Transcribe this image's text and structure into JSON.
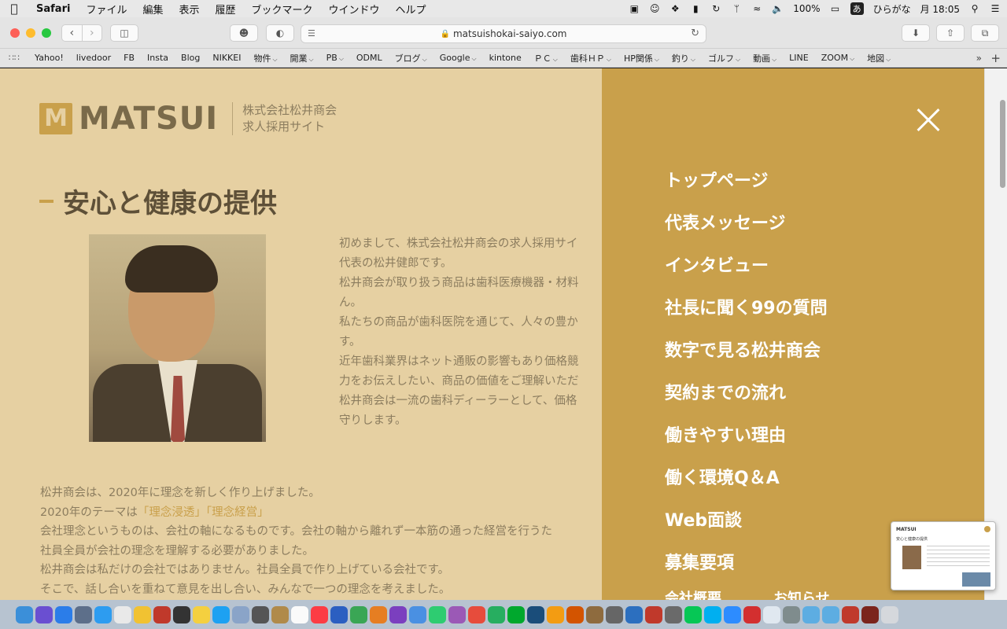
{
  "menubar": {
    "apple": "",
    "app_name": "Safari",
    "menus": [
      "ファイル",
      "編集",
      "表示",
      "履歴",
      "ブックマーク",
      "ウインドウ",
      "ヘルプ"
    ],
    "battery": "100%",
    "ime_char": "あ",
    "ime_label": "ひらがな",
    "clock": "月 18:05"
  },
  "toolbar": {
    "url": "matsuishokai-saiyo.com"
  },
  "bookmarks": [
    {
      "label": "Yahoo!",
      "folder": false
    },
    {
      "label": "livedoor",
      "folder": false
    },
    {
      "label": "FB",
      "folder": false
    },
    {
      "label": "Insta",
      "folder": false
    },
    {
      "label": "Blog",
      "folder": false
    },
    {
      "label": "NIKKEI",
      "folder": false
    },
    {
      "label": "物件",
      "folder": true
    },
    {
      "label": "開業",
      "folder": true
    },
    {
      "label": "PB",
      "folder": true
    },
    {
      "label": "ODML",
      "folder": false
    },
    {
      "label": "ブログ",
      "folder": true
    },
    {
      "label": "Google",
      "folder": true
    },
    {
      "label": "kintone",
      "folder": false
    },
    {
      "label": "ＰＣ",
      "folder": true
    },
    {
      "label": "歯科ＨＰ",
      "folder": true
    },
    {
      "label": "HP関係",
      "folder": true
    },
    {
      "label": "釣り",
      "folder": true
    },
    {
      "label": "ゴルフ",
      "folder": true
    },
    {
      "label": "動画",
      "folder": true
    },
    {
      "label": "LINE",
      "folder": false
    },
    {
      "label": "ZOOM",
      "folder": true
    },
    {
      "label": "地図",
      "folder": true
    }
  ],
  "page": {
    "logo_text": "MATSUI",
    "logo_sub_line1": "株式会社松井商会",
    "logo_sub_line2": "求人採用サイト",
    "section_title": "安心と健康の提供",
    "intro_lines": [
      "初めまして、株式会社松井商会の求人採用サイ",
      "代表の松井健郎です。",
      "松井商会が取り扱う商品は歯科医療機器・材料",
      "ん。",
      "私たちの商品が歯科医院を通じて、人々の豊か",
      "す。",
      "近年歯科業界はネット通販の影響もあり価格競",
      "力をお伝えしたい、商品の価値をご理解いただ",
      "松井商会は一流の歯科ディーラーとして、価格",
      "守りします。"
    ],
    "lower_line1": "松井商会は、2020年に理念を新しく作り上げました。",
    "lower_line2_prefix": "2020年のテーマは",
    "lower_line2_hl1": "「理念浸透」",
    "lower_line2_hl2": "「理念経営」",
    "lower_line3": "会社理念というものは、会社の軸になるものです。会社の軸から離れず一本筋の通った経営を行うた",
    "lower_line4": "社員全員が会社の理念を理解する必要がありました。",
    "lower_line5": "松井商会は私だけの会社ではありません。社員全員で作り上げている会社です。",
    "lower_line6": "そこで、話し合いを重ねて意見を出し合い、みんなで一つの理念を考えました。"
  },
  "overlay_nav": [
    "トップページ",
    "代表メッセージ",
    "インタビュー",
    "社長に聞く99の質問",
    "数字で見る松井商会",
    "契約までの流れ",
    "働きやすい理由",
    "働く環境Q＆A",
    "Web面談",
    "募集要項"
  ],
  "overlay_nav_partial": [
    "会社概要",
    "お知らせ"
  ],
  "thumbnail": {
    "logo": "MATSUI",
    "title": "安心と健康の提供"
  },
  "colors": {
    "accent_gold": "#c9a04b",
    "page_bg": "#e6d0a2",
    "overlay_text": "#ffffff"
  }
}
